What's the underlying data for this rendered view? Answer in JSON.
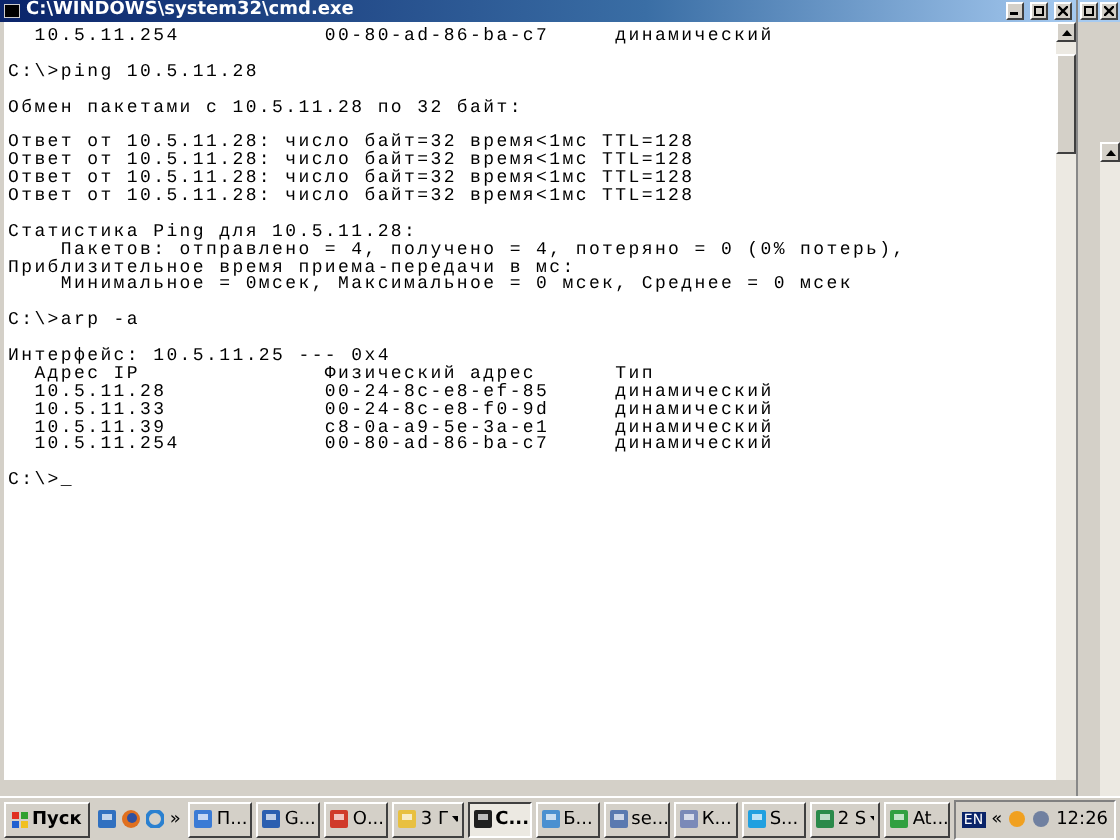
{
  "window": {
    "title": "C:\\WINDOWS\\system32\\cmd.exe"
  },
  "console": {
    "blocks": [
      [
        "  10.5.11.254           00-80-ad-86-ba-c7     динамический"
      ],
      [
        "C:\\>ping 10.5.11.28"
      ],
      [
        "Обмен пакетами с 10.5.11.28 по 32 байт:"
      ],
      [
        "Ответ от 10.5.11.28: число байт=32 время<1мс TTL=128",
        "Ответ от 10.5.11.28: число байт=32 время<1мс TTL=128",
        "Ответ от 10.5.11.28: число байт=32 время<1мс TTL=128",
        "Ответ от 10.5.11.28: число байт=32 время<1мс TTL=128"
      ],
      [
        "Статистика Ping для 10.5.11.28:",
        "    Пакетов: отправлено = 4, получено = 4, потеряно = 0 (0% потерь),",
        "Приблизительное время приема-передачи в мс:",
        "    Минимальное = 0мсек, Максимальное = 0 мсек, Среднее = 0 мсек"
      ],
      [
        "C:\\>arp -a"
      ],
      [
        "Интерфейс: 10.5.11.25 --- 0x4",
        "  Адрес IP              Физический адрес      Тип",
        "  10.5.11.28            00-24-8c-e8-ef-85     динамический",
        "  10.5.11.33            00-24-8c-e8-f0-9d     динамический",
        "  10.5.11.39            c8-0a-a9-5e-3a-e1     динамический",
        "  10.5.11.254           00-80-ad-86-ba-c7     динамический"
      ],
      [
        "C:\\>_"
      ]
    ]
  },
  "taskbar": {
    "start": "Пуск",
    "more": "»",
    "tasks": [
      {
        "label": "П...",
        "kind": "single",
        "color": "#3a7bd5",
        "selected": false
      },
      {
        "label": "G...",
        "kind": "single",
        "color": "#2a5fb0",
        "selected": false
      },
      {
        "label": "О...",
        "kind": "single",
        "color": "#d03a2a",
        "selected": false
      },
      {
        "label": "3 Г",
        "kind": "group",
        "color": "#e8c040",
        "selected": false
      },
      {
        "label": "C...",
        "kind": "single",
        "color": "#202020",
        "selected": true
      },
      {
        "label": "Б...",
        "kind": "single",
        "color": "#4a90d0",
        "selected": false
      },
      {
        "label": "se...",
        "kind": "single",
        "color": "#5a7ab0",
        "selected": false
      },
      {
        "label": "К...",
        "kind": "single",
        "color": "#7a8ab8",
        "selected": false
      },
      {
        "label": "S...",
        "kind": "single",
        "color": "#20a0e0",
        "selected": false
      },
      {
        "label": "2 S",
        "kind": "group",
        "color": "#2a8a4a",
        "selected": false
      },
      {
        "label": "At...",
        "kind": "single",
        "color": "#30a040",
        "selected": false
      }
    ],
    "tray": {
      "language": "EN",
      "expand": "«",
      "clock": "12:26"
    }
  }
}
